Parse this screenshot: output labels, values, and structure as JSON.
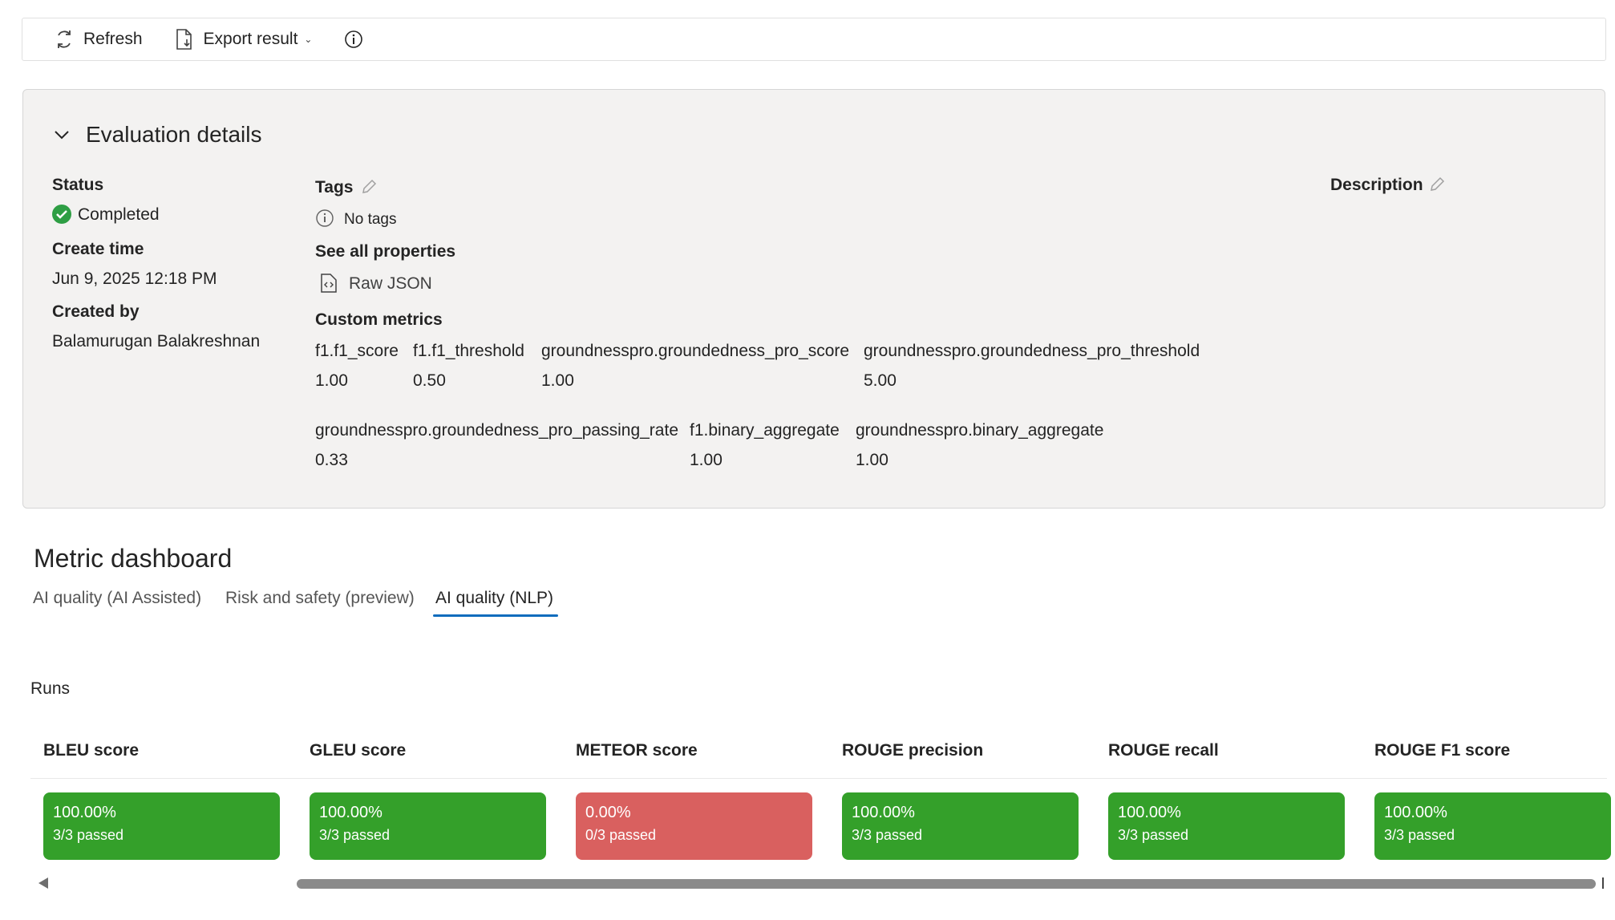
{
  "toolbar": {
    "refresh_label": "Refresh",
    "export_label": "Export result"
  },
  "details": {
    "title": "Evaluation details",
    "status_label": "Status",
    "status_value": "Completed",
    "create_time_label": "Create time",
    "create_time_value": "Jun 9, 2025 12:18 PM",
    "created_by_label": "Created by",
    "created_by_value": "Balamurugan Balakreshnan",
    "tags_label": "Tags",
    "tags_value": "No tags",
    "see_all_label": "See all properties",
    "raw_json_label": "Raw JSON",
    "custom_metrics_label": "Custom metrics",
    "description_label": "Description",
    "metrics_row1": [
      {
        "name": "f1.f1_score",
        "value": "1.00"
      },
      {
        "name": "f1.f1_threshold",
        "value": "0.50"
      },
      {
        "name": "groundnesspro.groundedness_pro_score",
        "value": "1.00"
      },
      {
        "name": "groundnesspro.groundedness_pro_threshold",
        "value": "5.00"
      }
    ],
    "metrics_row2": [
      {
        "name": "groundnesspro.groundedness_pro_passing_rate",
        "value": "0.33"
      },
      {
        "name": "f1.binary_aggregate",
        "value": "1.00"
      },
      {
        "name": "groundnesspro.binary_aggregate",
        "value": "1.00"
      }
    ]
  },
  "dashboard": {
    "title": "Metric dashboard",
    "tabs": [
      "AI quality (AI Assisted)",
      "Risk and safety (preview)",
      "AI quality (NLP)"
    ],
    "active_tab": "AI quality (NLP)",
    "runs_label": "Runs",
    "metrics": [
      {
        "name": "BLEU score",
        "percent": "100.00%",
        "passed": "3/3 passed",
        "status": "pass"
      },
      {
        "name": "GLEU score",
        "percent": "100.00%",
        "passed": "3/3 passed",
        "status": "pass"
      },
      {
        "name": "METEOR score",
        "percent": "0.00%",
        "passed": "0/3 passed",
        "status": "fail"
      },
      {
        "name": "ROUGE precision",
        "percent": "100.00%",
        "passed": "3/3 passed",
        "status": "pass"
      },
      {
        "name": "ROUGE recall",
        "percent": "100.00%",
        "passed": "3/3 passed",
        "status": "pass"
      },
      {
        "name": "ROUGE F1 score",
        "percent": "100.00%",
        "passed": "3/3 passed",
        "status": "pass"
      }
    ]
  },
  "colors": {
    "pass": "#34a02a",
    "fail": "#d9605f",
    "accent": "#0f6cbd"
  }
}
